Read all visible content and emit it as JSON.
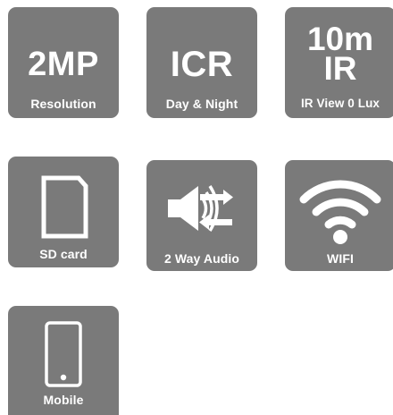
{
  "features": {
    "resolution": {
      "value": "2MP",
      "label": "Resolution",
      "icon": "resolution-text"
    },
    "icr": {
      "value": "ICR",
      "label": "Day & Night",
      "icon": "icr-text"
    },
    "ir": {
      "value_line1": "10m",
      "value_line2": "IR",
      "label": "IR View 0 Lux",
      "icon": "ir-text"
    },
    "sd_card": {
      "label": "SD card",
      "icon": "sd-card-icon"
    },
    "audio": {
      "label": "2 Way Audio",
      "icon": "speaker-arrows-icon"
    },
    "wifi": {
      "label": "WIFI",
      "icon": "wifi-icon"
    },
    "mobile": {
      "label": "Mobile",
      "icon": "smartphone-icon"
    }
  },
  "colors": {
    "tile_background": "#7a7a7a",
    "foreground": "#ffffff"
  }
}
